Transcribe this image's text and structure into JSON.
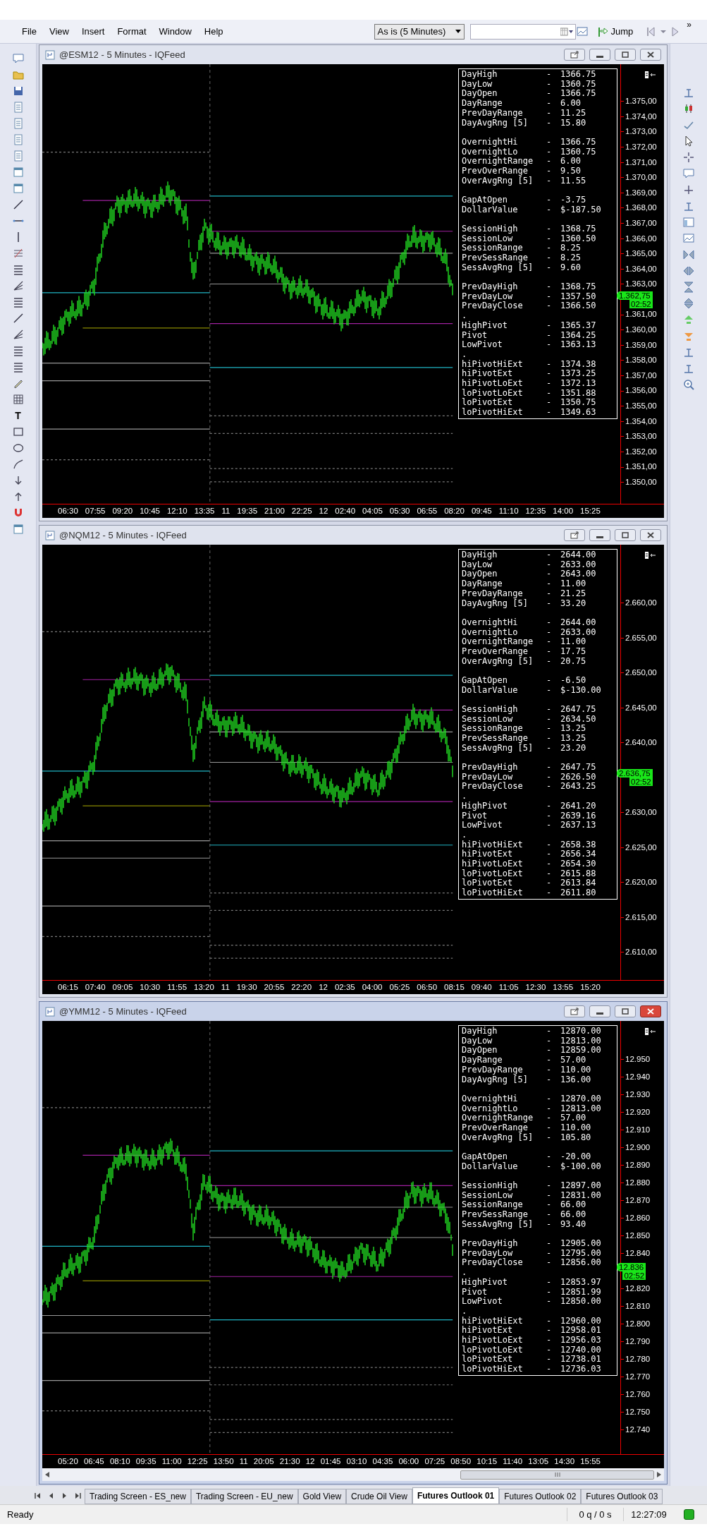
{
  "menu": [
    "File",
    "View",
    "Insert",
    "Format",
    "Window",
    "Help"
  ],
  "toolbar": {
    "interval": "As is (5 Minutes)",
    "jump": "Jump",
    "more": "»"
  },
  "left_toolbar": {
    "text_tool": "T"
  },
  "charts": [
    {
      "title": "@ESM12 - 5 Minutes - IQFeed",
      "active": false,
      "scrollbar": false,
      "info": [
        [
          {
            "label": "DayHigh",
            "sep": "-",
            "value": "1366.75"
          },
          {
            "label": "DayLow",
            "sep": "-",
            "value": "1360.75"
          },
          {
            "label": "DayOpen",
            "sep": "-",
            "value": "1366.75"
          },
          {
            "label": "DayRange",
            "sep": "-",
            "value": "6.00"
          },
          {
            "label": "PrevDayRange",
            "sep": "-",
            "value": "11.25"
          },
          {
            "label": "DayAvgRng [5]",
            "sep": "-",
            "value": "15.80"
          }
        ],
        [
          {
            "label": "OvernightHi",
            "sep": "-",
            "value": "1366.75"
          },
          {
            "label": "OvernightLo",
            "sep": "-",
            "value": "1360.75"
          },
          {
            "label": "OvernightRange",
            "sep": "-",
            "value": "6.00"
          },
          {
            "label": "PrevOverRange",
            "sep": "-",
            "value": "9.50"
          },
          {
            "label": "OverAvgRng [5]",
            "sep": "-",
            "value": "11.55"
          }
        ],
        [
          {
            "label": "GapAtOpen",
            "sep": "-",
            "value": "-3.75"
          },
          {
            "label": "DollarValue",
            "sep": "-",
            "value": "$-187.50"
          }
        ],
        [
          {
            "label": "SessionHigh",
            "sep": "-",
            "value": "1368.75"
          },
          {
            "label": "SessionLow",
            "sep": "-",
            "value": "1360.50"
          },
          {
            "label": "SessionRange",
            "sep": "-",
            "value": "8.25"
          },
          {
            "label": "PrevSessRange",
            "sep": "-",
            "value": "8.25"
          },
          {
            "label": "SessAvgRng [5]",
            "sep": "-",
            "value": "9.60"
          }
        ],
        [
          {
            "label": "PrevDayHigh",
            "sep": "-",
            "value": "1368.75"
          },
          {
            "label": "PrevDayLow",
            "sep": "-",
            "value": "1357.50"
          },
          {
            "label": "PrevDayClose",
            "sep": "-",
            "value": "1366.50"
          },
          {
            "label": "."
          },
          {
            "label": "HighPivot",
            "sep": "-",
            "value": "1365.37"
          },
          {
            "label": "Pivot",
            "sep": "-",
            "value": "1364.25"
          },
          {
            "label": "LowPivot",
            "sep": "-",
            "value": "1363.13"
          },
          {
            "label": "."
          },
          {
            "label": "hiPivotHiExt",
            "sep": "-",
            "value": "1374.38"
          },
          {
            "label": "hiPivotExt",
            "sep": "-",
            "value": "1373.25"
          },
          {
            "label": "hiPivotLoExt",
            "sep": "-",
            "value": "1372.13"
          },
          {
            "label": "loPivotLoExt",
            "sep": "-",
            "value": "1351.88"
          },
          {
            "label": "loPivotExt",
            "sep": "-",
            "value": "1350.75"
          },
          {
            "label": "loPivotHiExt",
            "sep": "-",
            "value": "1349.63"
          }
        ]
      ],
      "price_axis": [
        {
          "kind": "tick",
          "label": "1.375,00"
        },
        {
          "kind": "tick",
          "label": "1.374,00"
        },
        {
          "kind": "tick",
          "label": "1.373,00"
        },
        {
          "kind": "tick",
          "label": "1.372,00"
        },
        {
          "kind": "tick",
          "label": "1.371,00"
        },
        {
          "kind": "tick",
          "label": "1.370,00"
        },
        {
          "kind": "tick",
          "label": "1.369,00"
        },
        {
          "kind": "tick",
          "label": "1.368,00"
        },
        {
          "kind": "tick",
          "label": "1.367,00"
        },
        {
          "kind": "tick",
          "label": "1.366,00"
        },
        {
          "kind": "tick",
          "label": "1.365,00"
        },
        {
          "kind": "tick",
          "label": "1.364,00"
        },
        {
          "kind": "tick",
          "label": "1.363,00"
        },
        {
          "kind": "price",
          "label": "1.362,75",
          "timer": "02:52"
        },
        {
          "kind": "tick",
          "label": "1.361,00"
        },
        {
          "kind": "tick",
          "label": "1.360,00"
        },
        {
          "kind": "tick",
          "label": "1.359,00"
        },
        {
          "kind": "tick",
          "label": "1.358,00"
        },
        {
          "kind": "tick",
          "label": "1.357,00"
        },
        {
          "kind": "tick",
          "label": "1.356,00"
        },
        {
          "kind": "tick",
          "label": "1.355,00"
        },
        {
          "kind": "tick",
          "label": "1.354,00"
        },
        {
          "kind": "tick",
          "label": "1.353,00"
        },
        {
          "kind": "tick",
          "label": "1.352,00"
        },
        {
          "kind": "tick",
          "label": "1.351,00"
        },
        {
          "kind": "tick",
          "label": "1.350,00"
        }
      ],
      "time_axis": [
        "06:30",
        "07:55",
        "09:20",
        "10:45",
        "12:10",
        "13:35",
        "11",
        "19:35",
        "21:00",
        "22:25",
        "12",
        "02:40",
        "04:05",
        "05:30",
        "06:55",
        "08:20",
        "09:45",
        "11:10",
        "12:35",
        "14:00",
        "15:25"
      ]
    },
    {
      "title": "@NQM12 - 5 Minutes - IQFeed",
      "active": false,
      "scrollbar": false,
      "info": [
        [
          {
            "label": "DayHigh",
            "sep": "-",
            "value": "2644.00"
          },
          {
            "label": "DayLow",
            "sep": "-",
            "value": "2633.00"
          },
          {
            "label": "DayOpen",
            "sep": "-",
            "value": "2643.00"
          },
          {
            "label": "DayRange",
            "sep": "-",
            "value": "11.00"
          },
          {
            "label": "PrevDayRange",
            "sep": "-",
            "value": "21.25"
          },
          {
            "label": "DayAvgRng [5]",
            "sep": "-",
            "value": "33.20"
          }
        ],
        [
          {
            "label": "OvernightHi",
            "sep": "-",
            "value": "2644.00"
          },
          {
            "label": "OvernightLo",
            "sep": "-",
            "value": "2633.00"
          },
          {
            "label": "OvernightRange",
            "sep": "-",
            "value": "11.00"
          },
          {
            "label": "PrevOverRange",
            "sep": "-",
            "value": "17.75"
          },
          {
            "label": "OverAvgRng [5]",
            "sep": "-",
            "value": "20.75"
          }
        ],
        [
          {
            "label": "GapAtOpen",
            "sep": "-",
            "value": "-6.50"
          },
          {
            "label": "DollarValue",
            "sep": "-",
            "value": "$-130.00"
          }
        ],
        [
          {
            "label": "SessionHigh",
            "sep": "-",
            "value": "2647.75"
          },
          {
            "label": "SessionLow",
            "sep": "-",
            "value": "2634.50"
          },
          {
            "label": "SessionRange",
            "sep": "-",
            "value": "13.25"
          },
          {
            "label": "PrevSessRange",
            "sep": "-",
            "value": "13.25"
          },
          {
            "label": "SessAvgRng [5]",
            "sep": "-",
            "value": "23.20"
          }
        ],
        [
          {
            "label": "PrevDayHigh",
            "sep": "-",
            "value": "2647.75"
          },
          {
            "label": "PrevDayLow",
            "sep": "-",
            "value": "2626.50"
          },
          {
            "label": "PrevDayClose",
            "sep": "-",
            "value": "2643.25"
          },
          {
            "label": "."
          },
          {
            "label": "HighPivot",
            "sep": "-",
            "value": "2641.20"
          },
          {
            "label": "Pivot",
            "sep": "-",
            "value": "2639.16"
          },
          {
            "label": "LowPivot",
            "sep": "-",
            "value": "2637.13"
          },
          {
            "label": "."
          },
          {
            "label": "hiPivotHiExt",
            "sep": "-",
            "value": "2658.38"
          },
          {
            "label": "hiPivotExt",
            "sep": "-",
            "value": "2656.34"
          },
          {
            "label": "hiPivotLoExt",
            "sep": "-",
            "value": "2654.30"
          },
          {
            "label": "loPivotLoExt",
            "sep": "-",
            "value": "2615.88"
          },
          {
            "label": "loPivotExt",
            "sep": "-",
            "value": "2613.84"
          },
          {
            "label": "loPivotHiExt",
            "sep": "-",
            "value": "2611.80"
          }
        ]
      ],
      "price_axis": [
        {
          "kind": "tick",
          "label": "2.660,00"
        },
        {
          "kind": "tick",
          "label": "2.655,00"
        },
        {
          "kind": "tick",
          "label": "2.650,00"
        },
        {
          "kind": "tick",
          "label": "2.645,00"
        },
        {
          "kind": "tick",
          "label": "2.640,00"
        },
        {
          "kind": "price",
          "label": "2.636,75",
          "timer": "02:52"
        },
        {
          "kind": "tick",
          "label": "2.630,00"
        },
        {
          "kind": "tick",
          "label": "2.625,00"
        },
        {
          "kind": "tick",
          "label": "2.620,00"
        },
        {
          "kind": "tick",
          "label": "2.615,00"
        },
        {
          "kind": "tick",
          "label": "2.610,00"
        }
      ],
      "time_axis": [
        "06:15",
        "07:40",
        "09:05",
        "10:30",
        "11:55",
        "13:20",
        "11",
        "19:30",
        "20:55",
        "22:20",
        "12",
        "02:35",
        "04:00",
        "05:25",
        "06:50",
        "08:15",
        "09:40",
        "11:05",
        "12:30",
        "13:55",
        "15:20"
      ]
    },
    {
      "title": "@YMM12 - 5 Minutes - IQFeed",
      "active": true,
      "scrollbar": true,
      "info": [
        [
          {
            "label": "DayHigh",
            "sep": "-",
            "value": "12870.00"
          },
          {
            "label": "DayLow",
            "sep": "-",
            "value": "12813.00"
          },
          {
            "label": "DayOpen",
            "sep": "-",
            "value": "12859.00"
          },
          {
            "label": "DayRange",
            "sep": "-",
            "value": "57.00"
          },
          {
            "label": "PrevDayRange",
            "sep": "-",
            "value": "110.00"
          },
          {
            "label": "DayAvgRng [5]",
            "sep": "-",
            "value": "136.00"
          }
        ],
        [
          {
            "label": "OvernightHi",
            "sep": "-",
            "value": "12870.00"
          },
          {
            "label": "OvernightLo",
            "sep": "-",
            "value": "12813.00"
          },
          {
            "label": "OvernightRange",
            "sep": "-",
            "value": "57.00"
          },
          {
            "label": "PrevOverRange",
            "sep": "-",
            "value": "110.00"
          },
          {
            "label": "OverAvgRng [5]",
            "sep": "-",
            "value": "105.80"
          }
        ],
        [
          {
            "label": "GapAtOpen",
            "sep": "-",
            "value": "-20.00"
          },
          {
            "label": "DollarValue",
            "sep": "-",
            "value": "$-100.00"
          }
        ],
        [
          {
            "label": "SessionHigh",
            "sep": "-",
            "value": "12897.00"
          },
          {
            "label": "SessionLow",
            "sep": "-",
            "value": "12831.00"
          },
          {
            "label": "SessionRange",
            "sep": "-",
            "value": "66.00"
          },
          {
            "label": "PrevSessRange",
            "sep": "-",
            "value": "66.00"
          },
          {
            "label": "SessAvgRng [5]",
            "sep": "-",
            "value": "93.40"
          }
        ],
        [
          {
            "label": "PrevDayHigh",
            "sep": "-",
            "value": "12905.00"
          },
          {
            "label": "PrevDayLow",
            "sep": "-",
            "value": "12795.00"
          },
          {
            "label": "PrevDayClose",
            "sep": "-",
            "value": "12856.00"
          },
          {
            "label": "."
          },
          {
            "label": "HighPivot",
            "sep": "-",
            "value": "12853.97"
          },
          {
            "label": "Pivot",
            "sep": "-",
            "value": "12851.99"
          },
          {
            "label": "LowPivot",
            "sep": "-",
            "value": "12850.00"
          },
          {
            "label": "."
          },
          {
            "label": "hiPivotHiExt",
            "sep": "-",
            "value": "12960.00"
          },
          {
            "label": "hiPivotExt",
            "sep": "-",
            "value": "12958.01"
          },
          {
            "label": "hiPivotLoExt",
            "sep": "-",
            "value": "12956.03"
          },
          {
            "label": "loPivotLoExt",
            "sep": "-",
            "value": "12740.00"
          },
          {
            "label": "loPivotExt",
            "sep": "-",
            "value": "12738.01"
          },
          {
            "label": "loPivotHiExt",
            "sep": "-",
            "value": "12736.03"
          }
        ]
      ],
      "price_axis": [
        {
          "kind": "tick",
          "label": "12.950"
        },
        {
          "kind": "tick",
          "label": "12.940"
        },
        {
          "kind": "tick",
          "label": "12.930"
        },
        {
          "kind": "tick",
          "label": "12.920"
        },
        {
          "kind": "tick",
          "label": "12.910"
        },
        {
          "kind": "tick",
          "label": "12.900"
        },
        {
          "kind": "tick",
          "label": "12.890"
        },
        {
          "kind": "tick",
          "label": "12.880"
        },
        {
          "kind": "tick",
          "label": "12.870"
        },
        {
          "kind": "tick",
          "label": "12.860"
        },
        {
          "kind": "tick",
          "label": "12.850"
        },
        {
          "kind": "tick",
          "label": "12.840"
        },
        {
          "kind": "price",
          "label": "12.836",
          "timer": "02:52"
        },
        {
          "kind": "tick",
          "label": "12.820"
        },
        {
          "kind": "tick",
          "label": "12.810"
        },
        {
          "kind": "tick",
          "label": "12.800"
        },
        {
          "kind": "tick",
          "label": "12.790"
        },
        {
          "kind": "tick",
          "label": "12.780"
        },
        {
          "kind": "tick",
          "label": "12.770"
        },
        {
          "kind": "tick",
          "label": "12.760"
        },
        {
          "kind": "tick",
          "label": "12.750"
        },
        {
          "kind": "tick",
          "label": "12.740"
        }
      ],
      "time_axis": [
        "05:20",
        "06:45",
        "08:10",
        "09:35",
        "11:00",
        "12:25",
        "13:50",
        "11",
        "20:05",
        "21:30",
        "12",
        "01:45",
        "03:10",
        "04:35",
        "06:00",
        "07:25",
        "08:50",
        "10:15",
        "11:40",
        "13:05",
        "14:30",
        "15:55"
      ]
    }
  ],
  "tabs": [
    {
      "label": "Trading Screen - ES_new",
      "selected": false
    },
    {
      "label": "Trading Screen - EU_new",
      "selected": false
    },
    {
      "label": "Gold View",
      "selected": false
    },
    {
      "label": "Crude Oil View",
      "selected": false
    },
    {
      "label": "Futures Outlook 01",
      "selected": true
    },
    {
      "label": "Futures Outlook 02",
      "selected": false
    },
    {
      "label": "Futures Outlook 03",
      "selected": false
    }
  ],
  "status_bar": {
    "text": "Ready",
    "queue": "0 q / 0 s",
    "time": "12:27:09",
    "connected": true
  }
}
